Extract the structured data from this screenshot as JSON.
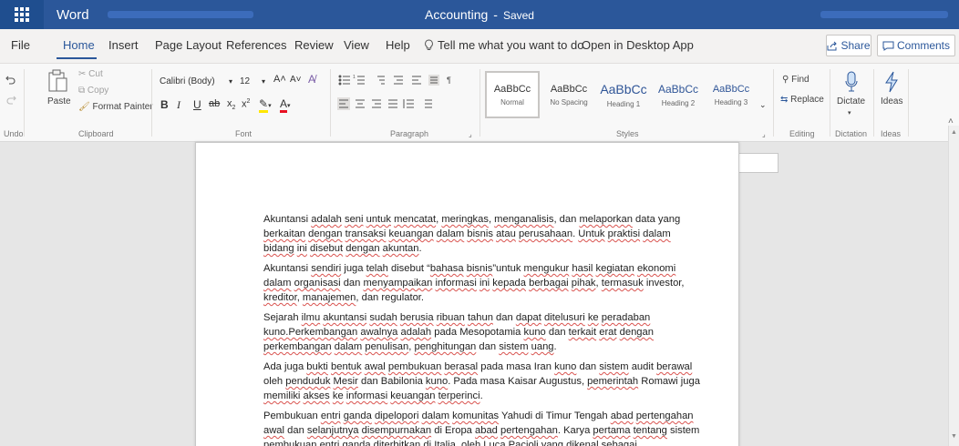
{
  "titlebar": {
    "app_name": "Word",
    "doc_title": "Accounting",
    "separator": "-",
    "status": "Saved"
  },
  "menu": {
    "items": [
      "File",
      "Home",
      "Insert",
      "Page Layout",
      "References",
      "Review",
      "View",
      "Help"
    ],
    "active": "Home",
    "tell_me": "Tell me what you want to do",
    "open_desktop": "Open in Desktop App",
    "share": "Share",
    "comments": "Comments"
  },
  "ribbon": {
    "undo_label": "Undo",
    "clipboard": {
      "paste": "Paste",
      "cut": "Cut",
      "copy": "Copy",
      "format_painter": "Format Painter",
      "label": "Clipboard"
    },
    "font": {
      "family": "Calibri (Body)",
      "size": "12",
      "label": "Font"
    },
    "paragraph": {
      "label": "Paragraph"
    },
    "styles": {
      "label": "Styles",
      "items": [
        {
          "sample": "AaBbCc",
          "name": "Normal"
        },
        {
          "sample": "AaBbCc",
          "name": "No Spacing"
        },
        {
          "sample": "AaBbCc",
          "name": "Heading 1"
        },
        {
          "sample": "AaBbCc",
          "name": "Heading 2"
        },
        {
          "sample": "AaBbCc",
          "name": "Heading 3"
        }
      ]
    },
    "editing": {
      "find": "Find",
      "replace": "Replace",
      "label": "Editing"
    },
    "dictation": {
      "button": "Dictate",
      "label": "Dictation"
    },
    "ideas": {
      "button": "Ideas",
      "label": "Ideas"
    }
  },
  "document": {
    "paragraphs": [
      [
        [
          "Akuntansi ",
          0
        ],
        [
          "adalah",
          1
        ],
        [
          " ",
          0
        ],
        [
          "seni",
          1
        ],
        [
          " ",
          0
        ],
        [
          "untuk",
          1
        ],
        [
          " ",
          0
        ],
        [
          "mencatat",
          1
        ],
        [
          ", ",
          0
        ],
        [
          "meringkas",
          1
        ],
        [
          ", ",
          0
        ],
        [
          "menganalisis",
          1
        ],
        [
          ", dan ",
          0
        ],
        [
          "melaporkan",
          1
        ],
        [
          " data yang ",
          0
        ],
        [
          "berkaitan",
          1
        ],
        [
          " ",
          0
        ],
        [
          "dengan",
          1
        ],
        [
          " ",
          0
        ],
        [
          "transaksi",
          1
        ],
        [
          " ",
          0
        ],
        [
          "keuangan",
          1
        ],
        [
          " ",
          0
        ],
        [
          "dalam",
          1
        ],
        [
          " ",
          0
        ],
        [
          "bisnis",
          1
        ],
        [
          " ",
          0
        ],
        [
          "atau",
          1
        ],
        [
          " ",
          0
        ],
        [
          "perusahaan",
          1
        ],
        [
          ". ",
          0
        ],
        [
          "Untuk",
          1
        ],
        [
          " ",
          0
        ],
        [
          "praktisi",
          1
        ],
        [
          " ",
          0
        ],
        [
          "dalam",
          1
        ],
        [
          " ",
          0
        ],
        [
          "bidang",
          1
        ],
        [
          " ",
          0
        ],
        [
          "ini",
          1
        ],
        [
          " ",
          0
        ],
        [
          "disebut",
          1
        ],
        [
          " ",
          0
        ],
        [
          "dengan",
          1
        ],
        [
          " ",
          0
        ],
        [
          "akuntan",
          1
        ],
        [
          ".",
          0
        ]
      ],
      [
        [
          "Akuntansi ",
          0
        ],
        [
          "sendiri",
          1
        ],
        [
          " juga ",
          0
        ],
        [
          "telah",
          1
        ],
        [
          " disebut “",
          0
        ],
        [
          "bahasa",
          1
        ],
        [
          " ",
          0
        ],
        [
          "bisnis",
          1
        ],
        [
          "”untuk  ",
          0
        ],
        [
          "mengukur",
          1
        ],
        [
          " ",
          0
        ],
        [
          "hasil",
          1
        ],
        [
          " ",
          0
        ],
        [
          "kegiatan",
          1
        ],
        [
          " ",
          0
        ],
        [
          "ekonomi",
          1
        ],
        [
          " ",
          0
        ],
        [
          "dalam",
          1
        ],
        [
          " ",
          0
        ],
        [
          "organisasi",
          1
        ],
        [
          " dan ",
          0
        ],
        [
          "menyampaikan",
          1
        ],
        [
          " ",
          0
        ],
        [
          "informasi",
          1
        ],
        [
          " ",
          0
        ],
        [
          "ini",
          1
        ],
        [
          " ",
          0
        ],
        [
          "kepada",
          1
        ],
        [
          " ",
          0
        ],
        [
          "berbagai",
          1
        ],
        [
          " ",
          0
        ],
        [
          "pihak",
          1
        ],
        [
          ", ",
          0
        ],
        [
          "termasuk",
          1
        ],
        [
          " investor, ",
          0
        ],
        [
          "kreditor",
          1
        ],
        [
          ", ",
          0
        ],
        [
          "manajemen",
          1
        ],
        [
          ", dan regulator.",
          0
        ]
      ],
      [
        [
          "Sejarah ",
          0
        ],
        [
          "ilmu",
          1
        ],
        [
          " ",
          0
        ],
        [
          "akuntansi",
          1
        ],
        [
          " ",
          0
        ],
        [
          "sudah",
          1
        ],
        [
          " ",
          0
        ],
        [
          "berusia",
          1
        ],
        [
          " ",
          0
        ],
        [
          "ribuan",
          1
        ],
        [
          " ",
          0
        ],
        [
          "tahun",
          1
        ],
        [
          " dan ",
          0
        ],
        [
          "dapat",
          1
        ],
        [
          " ",
          0
        ],
        [
          "ditelusuri",
          1
        ],
        [
          " ",
          0
        ],
        [
          "ke",
          1
        ],
        [
          " ",
          0
        ],
        [
          "peradaban",
          1
        ],
        [
          " ",
          0
        ],
        [
          "kuno.Perkembangan",
          1
        ],
        [
          " ",
          0
        ],
        [
          "awalnya",
          1
        ],
        [
          " ",
          0
        ],
        [
          "adalah",
          1
        ],
        [
          " pada Mesopotamia ",
          0
        ],
        [
          "kuno",
          1
        ],
        [
          " dan ",
          0
        ],
        [
          "terkait",
          1
        ],
        [
          " ",
          0
        ],
        [
          "erat",
          1
        ],
        [
          " ",
          0
        ],
        [
          "dengan",
          1
        ],
        [
          " ",
          0
        ],
        [
          "perkembangan",
          1
        ],
        [
          " ",
          0
        ],
        [
          "dalam",
          1
        ],
        [
          " ",
          0
        ],
        [
          "penulisan",
          1
        ],
        [
          ", ",
          0
        ],
        [
          "penghitungan",
          1
        ],
        [
          " dan ",
          0
        ],
        [
          "sistem",
          1
        ],
        [
          " ",
          0
        ],
        [
          "uang",
          1
        ],
        [
          ".",
          0
        ]
      ],
      [
        [
          "Ada juga ",
          0
        ],
        [
          "bukti",
          1
        ],
        [
          " ",
          0
        ],
        [
          "bentuk",
          1
        ],
        [
          " ",
          0
        ],
        [
          "awal",
          1
        ],
        [
          " ",
          0
        ],
        [
          "pembukuan",
          1
        ],
        [
          " ",
          0
        ],
        [
          "berasal",
          1
        ],
        [
          " pada masa Iran ",
          0
        ],
        [
          "kuno",
          1
        ],
        [
          " dan ",
          0
        ],
        [
          "sistem",
          1
        ],
        [
          " audit ",
          0
        ],
        [
          "berawal",
          1
        ],
        [
          " oleh ",
          0
        ],
        [
          "penduduk",
          1
        ],
        [
          " ",
          0
        ],
        [
          "Mesir",
          1
        ],
        [
          " dan Babilonia ",
          0
        ],
        [
          "kuno",
          1
        ],
        [
          ".  Pada masa Kaisar Augustus, ",
          0
        ],
        [
          "pemerintah",
          1
        ],
        [
          " Romawi juga ",
          0
        ],
        [
          "memiliki",
          1
        ],
        [
          " ",
          0
        ],
        [
          "akses",
          1
        ],
        [
          " ",
          0
        ],
        [
          "ke",
          1
        ],
        [
          " ",
          0
        ],
        [
          "informasi",
          1
        ],
        [
          " ",
          0
        ],
        [
          "keuangan",
          1
        ],
        [
          " ",
          0
        ],
        [
          "terperinci",
          1
        ],
        [
          ".",
          0
        ]
      ],
      [
        [
          "Pembukuan ",
          0
        ],
        [
          "entri",
          1
        ],
        [
          " ",
          0
        ],
        [
          "ganda",
          1
        ],
        [
          " ",
          0
        ],
        [
          "dipelopori",
          1
        ],
        [
          " ",
          0
        ],
        [
          "dalam",
          1
        ],
        [
          " ",
          0
        ],
        [
          "komunitas",
          1
        ],
        [
          " Yahudi di Timur Tengah ",
          0
        ],
        [
          "abad",
          1
        ],
        [
          " ",
          0
        ],
        [
          "pertengahan",
          1
        ],
        [
          " ",
          0
        ],
        [
          "awal",
          1
        ],
        [
          " dan ",
          0
        ],
        [
          "selanjutnya",
          1
        ],
        [
          " ",
          0
        ],
        [
          "disempurnakan",
          1
        ],
        [
          " di Eropa ",
          0
        ],
        [
          "abad",
          1
        ],
        [
          " ",
          0
        ],
        [
          "pertengahan",
          1
        ],
        [
          ".  Karya ",
          0
        ],
        [
          "pertama",
          1
        ],
        [
          " ",
          0
        ],
        [
          "tentang",
          1
        ],
        [
          " sistem pembukuan entri ganda diterbitkan di Italia, oleh Luca Pacioli yang dikenal sebagai",
          0
        ]
      ]
    ]
  },
  "colors": {
    "word_blue": "#2b579a",
    "heading_blue": "#2f5597",
    "spell_red": "#d9534f"
  }
}
